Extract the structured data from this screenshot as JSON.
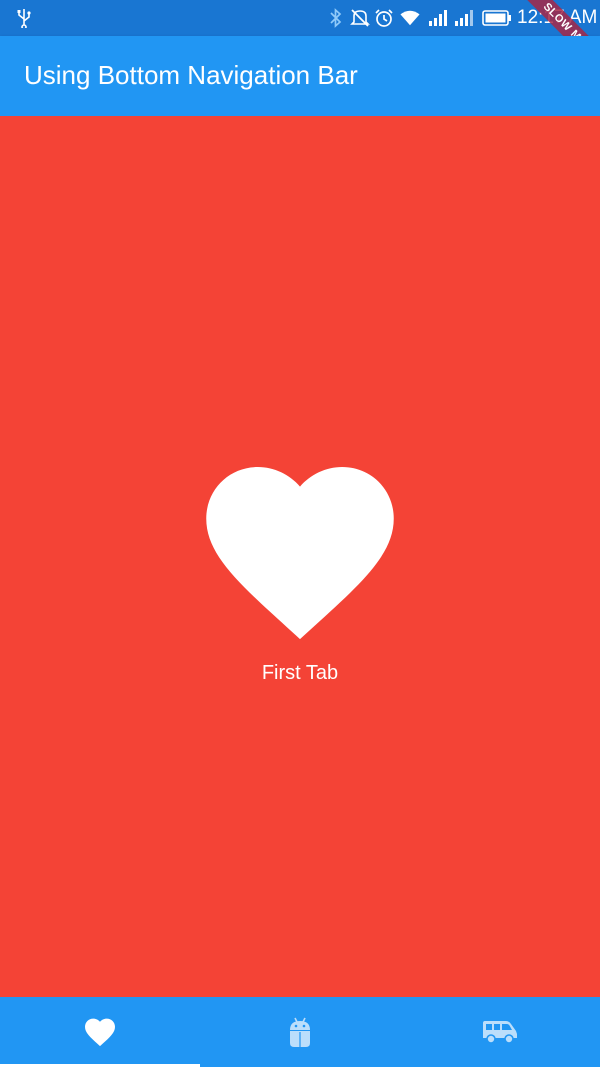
{
  "status_bar": {
    "time": "12:17 AM",
    "icons": [
      "usb-icon",
      "bluetooth-icon",
      "mute-icon",
      "alarm-icon",
      "wifi-icon",
      "signal-icon",
      "signal-icon",
      "battery-icon"
    ]
  },
  "debug_banner": {
    "text": "SLOW MODE"
  },
  "app_bar": {
    "title": "Using Bottom Navigation Bar",
    "color": "#2196F3"
  },
  "body": {
    "background": "#F44336",
    "icon": "heart-icon",
    "label": "First Tab"
  },
  "bottom_nav": {
    "color": "#2196F3",
    "items": [
      {
        "icon": "heart-icon",
        "selected": true
      },
      {
        "icon": "android-icon",
        "selected": false
      },
      {
        "icon": "van-icon",
        "selected": false
      }
    ]
  }
}
